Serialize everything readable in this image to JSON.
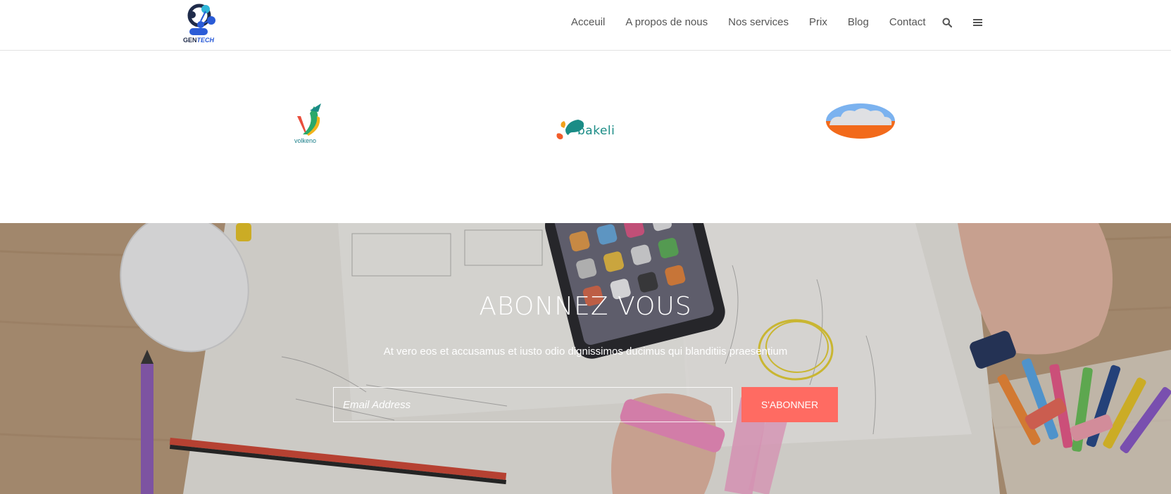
{
  "header": {
    "logo": {
      "name": "gentech-logo",
      "text_gen": "GEN",
      "text_tech": "TECH"
    },
    "nav": {
      "items": [
        {
          "label": "Acceuil"
        },
        {
          "label": "A propos de nous"
        },
        {
          "label": "Nos services"
        },
        {
          "label": "Prix"
        },
        {
          "label": "Blog"
        },
        {
          "label": "Contact"
        }
      ],
      "icons": [
        "search-icon",
        "menu-icon"
      ]
    }
  },
  "clients": {
    "logos": [
      {
        "name": "volkeno-logo",
        "caption": "volkeno"
      },
      {
        "name": "bakeli-logo",
        "caption": "bakeli"
      },
      {
        "name": "cloud-logo"
      }
    ]
  },
  "subscribe": {
    "title": "ABONNEZ VOUS",
    "text": "At vero eos et accusamus et iusto odio dignissimos ducimus qui blanditiis praesentium",
    "email_placeholder": "Email Address",
    "email_value": "",
    "button_label": "S'ABONNER"
  },
  "colors": {
    "accent": "#ff6b62",
    "nav_text": "#555555",
    "header_border": "#e3e3e3",
    "title_white": "#ffffff"
  }
}
